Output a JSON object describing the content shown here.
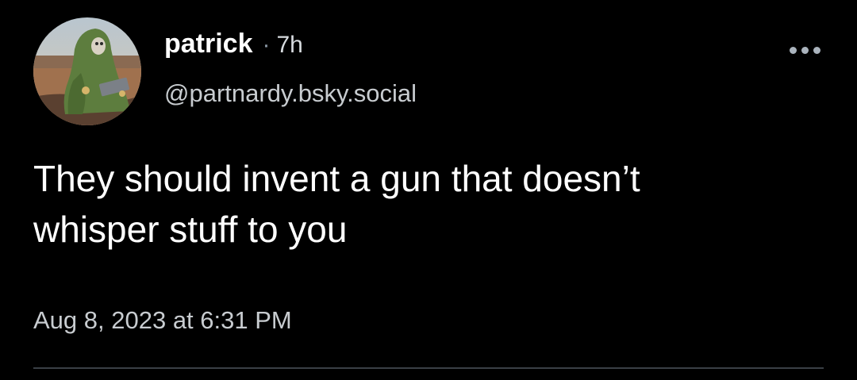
{
  "post": {
    "author": {
      "display_name": "patrick",
      "separator": "·",
      "time_ago": "7h",
      "handle": "@partnardy.bsky.social"
    },
    "text_line_1": "They should invent a gun that doesn’t",
    "text_line_2": "whisper stuff to you",
    "timestamp": "Aug 8, 2023 at 6:31 PM",
    "more_icon": "ellipsis-icon"
  },
  "colors": {
    "background": "#000000",
    "primary_text": "#ffffff",
    "secondary_text": "#c8ccd0",
    "divider": "#3a3f45"
  }
}
